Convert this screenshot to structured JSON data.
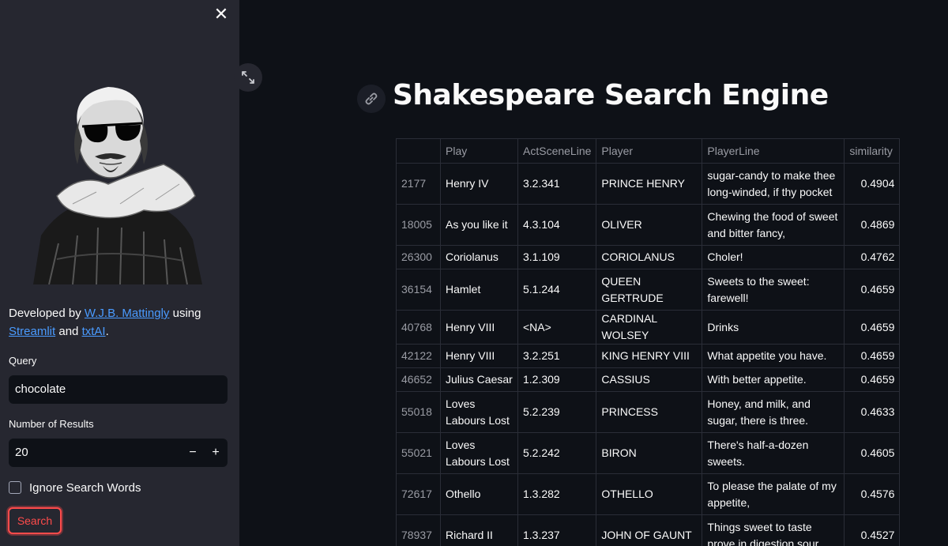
{
  "sidebar": {
    "close_symbol": "✕",
    "developed_prefix": "Developed by ",
    "author_link": "W.J.B. Mattingly",
    "using_text": " using ",
    "streamlit_link": "Streamlit",
    "and_text": " and ",
    "txtai_link": "txtAI",
    "period": ".",
    "query_label": "Query",
    "query_value": "chocolate",
    "num_results_label": "Number of Results",
    "num_results_value": "20",
    "minus_symbol": "−",
    "plus_symbol": "+",
    "ignore_label": "Ignore Search Words",
    "ignore_checked": false,
    "search_button": "Search"
  },
  "main": {
    "title": "Shakespeare Search Engine",
    "table": {
      "columns": [
        "",
        "Play",
        "ActSceneLine",
        "Player",
        "PlayerLine",
        "similarity"
      ],
      "rows": [
        {
          "idx": "2177",
          "play": "Henry IV",
          "asl": "3.2.341",
          "player": "PRINCE HENRY",
          "line": "sugar-candy to make thee long-winded, if thy pocket",
          "sim": "0.4904"
        },
        {
          "idx": "18005",
          "play": "As you like it",
          "asl": "4.3.104",
          "player": "OLIVER",
          "line": "Chewing the food of sweet and bitter fancy,",
          "sim": "0.4869"
        },
        {
          "idx": "26300",
          "play": "Coriolanus",
          "asl": "3.1.109",
          "player": "CORIOLANUS",
          "line": "Choler!",
          "sim": "0.4762"
        },
        {
          "idx": "36154",
          "play": "Hamlet",
          "asl": "5.1.244",
          "player": "QUEEN GERTRUDE",
          "line": "Sweets to the sweet: farewell!",
          "sim": "0.4659"
        },
        {
          "idx": "40768",
          "play": "Henry VIII",
          "asl": "<NA>",
          "player": "CARDINAL WOLSEY",
          "line": "Drinks",
          "sim": "0.4659"
        },
        {
          "idx": "42122",
          "play": "Henry VIII",
          "asl": "3.2.251",
          "player": "KING HENRY VIII",
          "line": "What appetite you have.",
          "sim": "0.4659"
        },
        {
          "idx": "46652",
          "play": "Julius Caesar",
          "asl": "1.2.309",
          "player": "CASSIUS",
          "line": "With better appetite.",
          "sim": "0.4659"
        },
        {
          "idx": "55018",
          "play": "Loves Labours Lost",
          "asl": "5.2.239",
          "player": "PRINCESS",
          "line": "Honey, and milk, and sugar, there is three.",
          "sim": "0.4633"
        },
        {
          "idx": "55021",
          "play": "Loves Labours Lost",
          "asl": "5.2.242",
          "player": "BIRON",
          "line": "There's half-a-dozen sweets.",
          "sim": "0.4605"
        },
        {
          "idx": "72617",
          "play": "Othello",
          "asl": "1.3.282",
          "player": "OTHELLO",
          "line": "To please the palate of my appetite,",
          "sim": "0.4576"
        },
        {
          "idx": "78937",
          "play": "Richard II",
          "asl": "1.3.237",
          "player": "JOHN OF GAUNT",
          "line": "Things sweet to taste prove in digestion sour.",
          "sim": "0.4527"
        }
      ]
    }
  },
  "icons": {
    "close": "close-icon",
    "expand": "expand-icon",
    "link": "link-icon",
    "portrait": "shakespeare-portrait"
  },
  "colors": {
    "background": "#0e1117",
    "sidebar": "#262730",
    "accent": "#ff4b4b",
    "link": "#4a9bff"
  }
}
